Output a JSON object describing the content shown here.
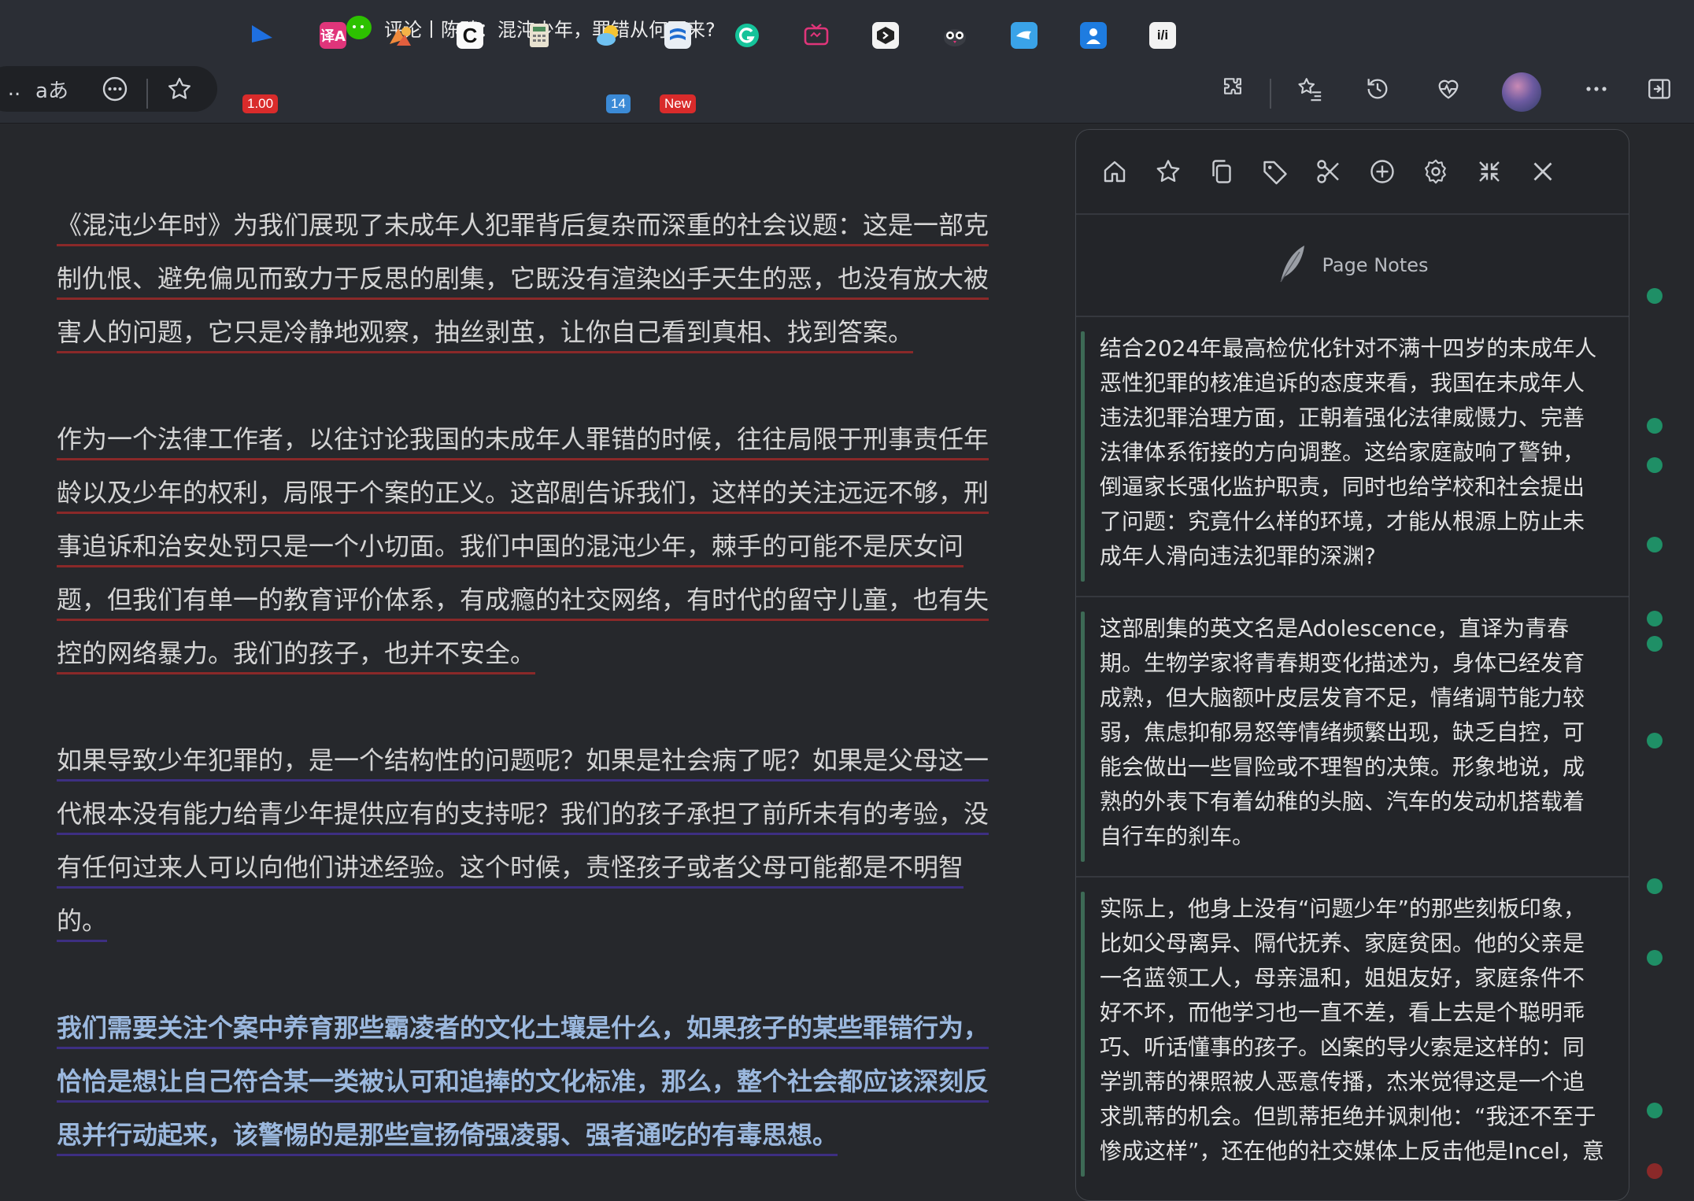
{
  "window": {
    "title": "评论丨陈碧：混沌少年，罪错从何而来?"
  },
  "toolbar": {
    "address_trailing": "..",
    "read_aloud": "aあ",
    "badges": {
      "ext_1": "1.00",
      "ext_badge_14": "14",
      "ext_new": "New"
    },
    "ext_c": "C",
    "ext_if": "i/i",
    "ext_text": "译A"
  },
  "article": {
    "p1": [
      "《混沌少年时》为我们展现了未成年人犯罪背后复杂而深重的社会议题：这是一部克",
      "制仇恨、避免偏见而致力于反思的剧集，它既没有渲染凶手天生的恶，也没有放大被",
      "害人的问题，它只是冷静地观察，抽丝剥茧，让你自己看到真相、找到答案。"
    ],
    "p2": [
      "作为一个法律工作者，以往讨论我国的未成年人罪错的时候，往往局限于刑事责任年",
      "龄以及少年的权利，局限于个案的正义。这部剧告诉我们，这样的关注远远不够，刑",
      "事追诉和治安处罚只是一个小切面。我们中国的混沌少年，棘手的可能不是厌女问",
      "题，但我们有单一的教育评价体系，有成瘾的社交网络，有时代的留守儿童，也有失",
      "控的网络暴力。我们的孩子，也并不安全。"
    ],
    "p3": [
      "如果导致少年犯罪的，是一个结构性的问题呢？如果是社会病了呢？如果是父母这一",
      "代根本没有能力给青少年提供应有的支持呢？我们的孩子承担了前所未有的考验，没",
      "有任何过来人可以向他们讲述经验。这个时候，责怪孩子或者父母可能都是不明智",
      "的。"
    ],
    "p4": [
      "我们需要关注个案中养育那些霸凌者的文化土壤是什么，如果孩子的某些罪错行为，",
      "恰恰是想让自己符合某一类被认可和追捧的文化标准，那么，整个社会都应该深刻反",
      "思并行动起来，该警惕的是那些宣扬倚强凌弱、强者通吃的有毒思想。"
    ]
  },
  "panel": {
    "header_title": "Page Notes",
    "icons": [
      "home-icon",
      "star-icon",
      "copy-icon",
      "tag-icon",
      "scissors-icon",
      "add-circle-icon",
      "settings-icon",
      "collapse-icon",
      "close-icon"
    ],
    "notes": [
      "结合2024年最高检优化针对不满十四岁的未成年人恶性犯罪的核准追诉的态度来看，我国在未成年人违法犯罪治理方面，正朝着强化法律威慑力、完善法律体系衔接的方向调整。这给家庭敲响了警钟，倒逼家长强化监护职责，同时也给学校和社会提出了问题：究竟什么样的环境，才能从根源上防止未成年人滑向违法犯罪的深渊?",
      "这部剧集的英文名是Adolescence，直译为青春期。生物学家将青春期变化描述为，身体已经发育成熟，但大脑额叶皮层发育不足，情绪调节能力较弱，焦虑抑郁易怒等情绪频繁出现，缺乏自控，可能会做出一些冒险或不理智的决策。形象地说，成熟的外表下有着幼稚的头脑、汽车的发动机搭载着自行车的刹车。",
      "实际上，他身上没有“问题少年”的那些刻板印象，比如父母离异、隔代抚养、家庭贫困。他的父亲是一名蓝领工人，母亲温和，姐姐友好，家庭条件不好不坏，而他学习也一直不差，看上去是个聪明乖巧、听话懂事的孩子。凶案的导火索是这样的：同学凯蒂的裸照被人恶意传播，杰米觉得这是一个追求凯蒂的机会。但凯蒂拒绝并讽刺他：“我还不至于惨成这样”，还在他的社交媒体上反击他是Incel，意"
    ]
  },
  "colors": {
    "background": "#26282c",
    "toolbar": "#2b2e35",
    "highlight_red": "#8a2929",
    "highlight_purple": "#3d2f82",
    "bold_text": "#9bb8de",
    "note_bar": "#3d6a55",
    "gutter_dot": "#1f8f66"
  }
}
